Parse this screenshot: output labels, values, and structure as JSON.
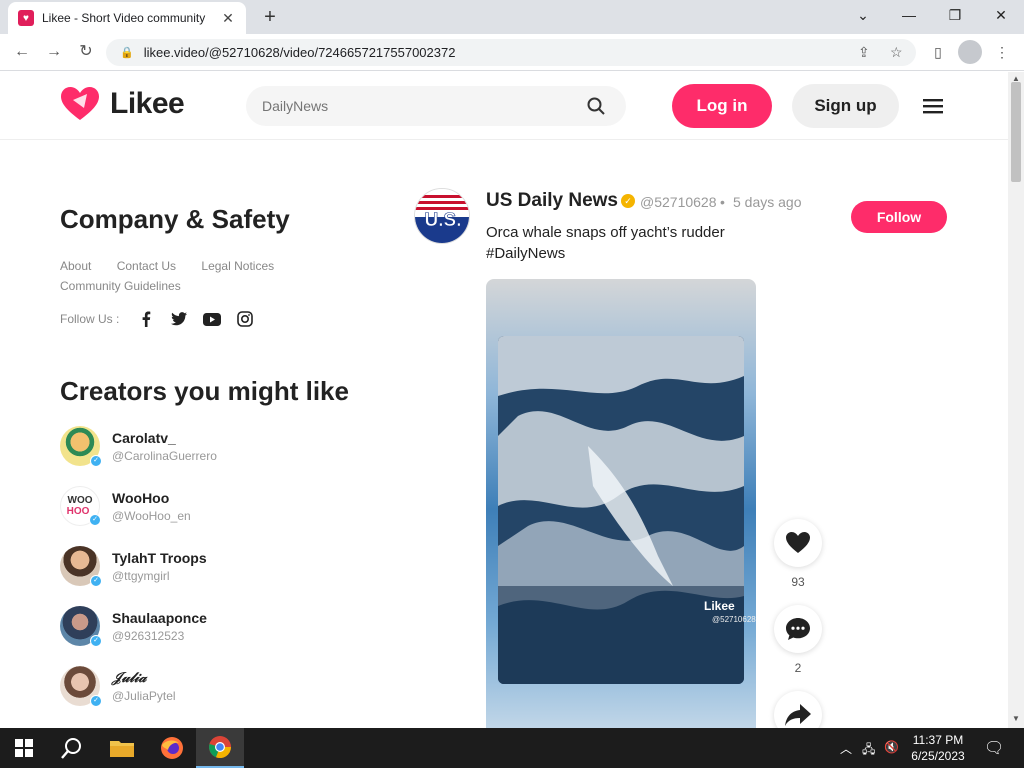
{
  "browser": {
    "tab_title": "Likee - Short Video community",
    "url": "likee.video/@52710628/video/7246657217557002372"
  },
  "header": {
    "logo_text": "Likee",
    "search_placeholder": "DailyNews",
    "login_label": "Log in",
    "signup_label": "Sign up"
  },
  "sidebar": {
    "company_title": "Company & Safety",
    "links": [
      "About",
      "Contact Us",
      "Legal Notices",
      "Community Guidelines"
    ],
    "follow_us_label": "Follow Us :",
    "socials": [
      "facebook-icon",
      "twitter-icon",
      "youtube-icon",
      "instagram-icon"
    ],
    "creators_title": "Creators you might like",
    "creators": [
      {
        "name": "Carolatv_",
        "handle": "@CarolinaGuerrero"
      },
      {
        "name": "WooHoo",
        "handle": "@WooHoo_en"
      },
      {
        "name": "TylahT Troops",
        "handle": "@ttgymgirl"
      },
      {
        "name": "Shaulaaponce",
        "handle": "@926312523"
      },
      {
        "name": "𝒥𝓊𝓁𝒾𝒶",
        "handle": "@JuliaPytel"
      }
    ]
  },
  "post": {
    "author_name": "US Daily News",
    "author_handle": "@52710628",
    "separator": "•",
    "time": "5 days ago",
    "follow_label": "Follow",
    "caption": "Orca whale snaps off yacht’s rudder #DailyNews",
    "watermark": "Likee",
    "watermark_id": "@52710628",
    "likes": "93",
    "comments": "2"
  },
  "taskbar": {
    "time": "11:37 PM",
    "date": "6/25/2023"
  },
  "colors": {
    "brand_pink": "#fe2c6a",
    "verified_gold": "#f5b400"
  }
}
